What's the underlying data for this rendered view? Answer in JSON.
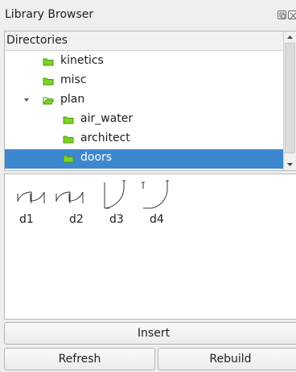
{
  "window": {
    "title": "Library Browser",
    "float_icon": "float-icon",
    "close_icon": "close-icon"
  },
  "tree": {
    "header": "Directories",
    "items": [
      {
        "label": "kinetics",
        "depth": 1,
        "expanded": false,
        "selected": false,
        "icon": "folder-icon"
      },
      {
        "label": "misc",
        "depth": 1,
        "expanded": false,
        "selected": false,
        "icon": "folder-icon"
      },
      {
        "label": "plan",
        "depth": 1,
        "expanded": true,
        "selected": false,
        "icon": "folder-open-icon"
      },
      {
        "label": "air_water",
        "depth": 2,
        "expanded": false,
        "selected": false,
        "icon": "folder-icon"
      },
      {
        "label": "architect",
        "depth": 2,
        "expanded": false,
        "selected": false,
        "icon": "folder-icon"
      },
      {
        "label": "doors",
        "depth": 2,
        "expanded": false,
        "selected": true,
        "icon": "folder-icon"
      }
    ]
  },
  "library_items": [
    {
      "label": "d1",
      "icon": "door-swing-icon"
    },
    {
      "label": "d2",
      "icon": "door-swing-icon"
    },
    {
      "label": "d3",
      "icon": "door-swing-icon"
    },
    {
      "label": "d4",
      "icon": "door-swing-icon"
    }
  ],
  "buttons": {
    "insert": "Insert",
    "refresh": "Refresh",
    "rebuild": "Rebuild"
  },
  "colors": {
    "selection": "#3d87cf",
    "folder": "#7bd32a",
    "folder_dark": "#4e9a06"
  }
}
